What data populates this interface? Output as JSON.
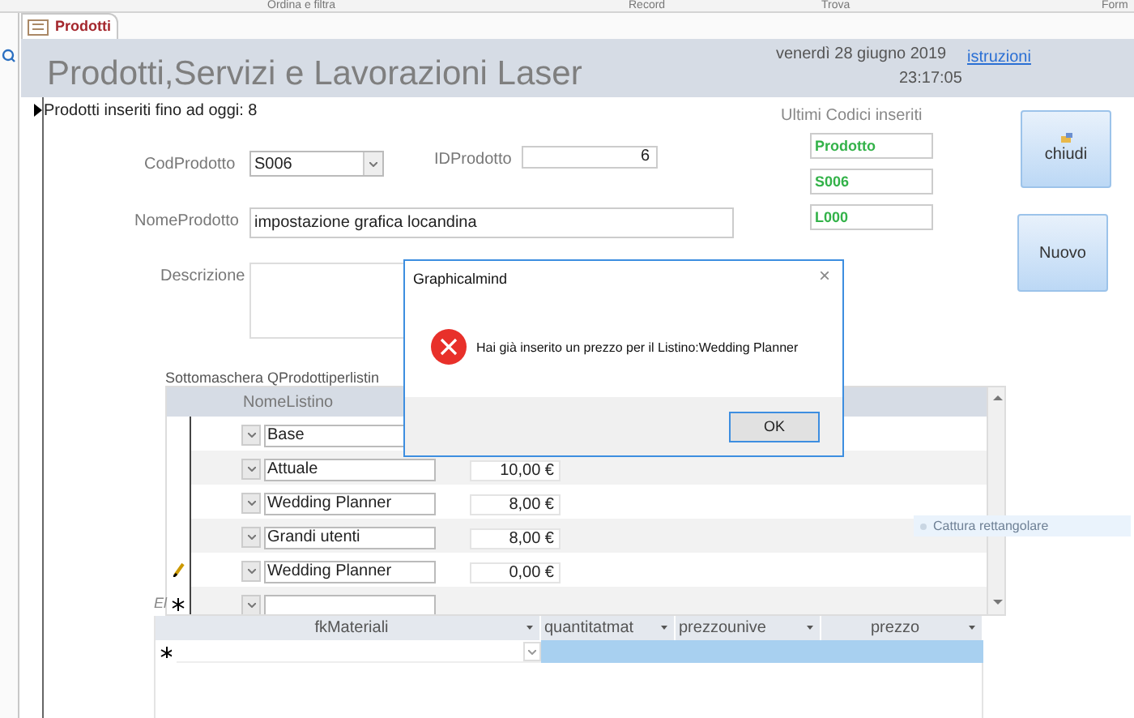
{
  "ribbon": {
    "groups": [
      "Ordina e filtra",
      "Record",
      "Trova",
      "Form"
    ]
  },
  "tabs": [
    {
      "label": "Prodotti",
      "selected": true
    }
  ],
  "header": {
    "title": "Prodotti,Servizi e Lavorazioni Laser",
    "date": "venerdì 28 giugno 2019",
    "time": "23:17:05",
    "link": "istruzioni"
  },
  "form": {
    "count_text": "Prodotti inseriti fino ad oggi: 8",
    "fields": [
      {
        "label": "CodProdotto",
        "value": "S006",
        "kind": "combo"
      },
      {
        "label": "IDProdotto",
        "value": "6",
        "kind": "number"
      },
      {
        "label": "NomeProdotto",
        "value": "impostazione grafica locandina",
        "kind": "text"
      },
      {
        "label": "Descrizione",
        "kind": "memo"
      }
    ],
    "recent": {
      "label": "Ultimi Codici inseriti",
      "values": [
        "Prodotto",
        "S006",
        "L000"
      ]
    },
    "buttons": [
      {
        "label": "chiudi",
        "kind": "icon"
      },
      {
        "label": "Nuovo",
        "kind": "plain"
      }
    ]
  },
  "subform": {
    "label": "Sottomaschera QProdottiperlistin",
    "column": "NomeListino",
    "rows": [
      {
        "listino": "Base",
        "editing": false
      },
      {
        "listino": "Attuale",
        "price": "10,00 €",
        "editing": false
      },
      {
        "listino": "Wedding Planner",
        "price": "8,00 €",
        "editing": false
      },
      {
        "listino": "Grandi utenti",
        "price": "8,00 €",
        "editing": false
      },
      {
        "listino": "Wedding Planner",
        "price": "0,00 €",
        "editing": true
      }
    ],
    "new_row": true,
    "cut_label": "El"
  },
  "materials": {
    "columns": [
      "fkMateriali",
      "quantitatmat",
      "prezzounive",
      "prezzo"
    ]
  },
  "dialog": {
    "title": "Graphicalmind",
    "close": "×",
    "message": "Hai già inserito un prezzo per il Listino:Wedding Planner",
    "button": "OK"
  },
  "overlay": {
    "text": "Cattura rettangolare"
  }
}
